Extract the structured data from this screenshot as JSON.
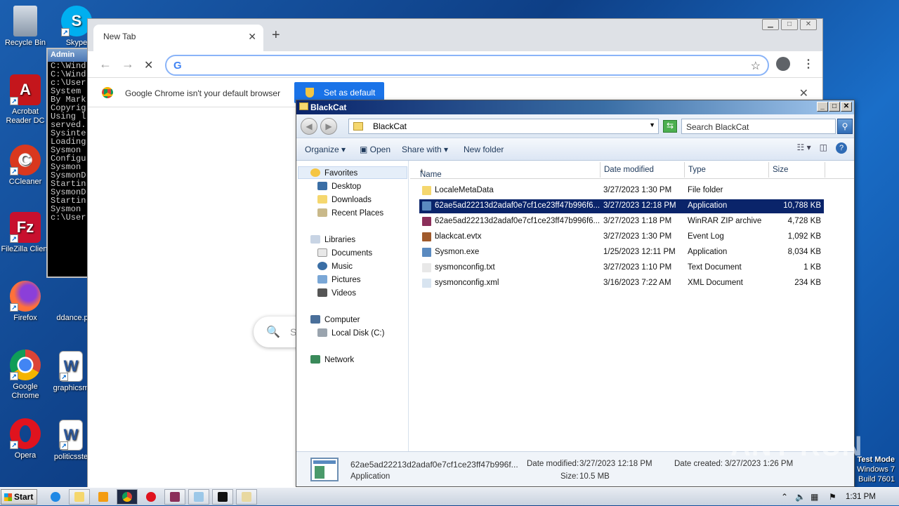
{
  "desktop": {
    "icons": [
      {
        "label": "Recycle Bin",
        "color": "#9aa9b8"
      },
      {
        "label": "Acrobat Reader DC",
        "color": "#c4161c"
      },
      {
        "label": "CCleaner",
        "color": "#d9381e"
      },
      {
        "label": "FileZilla Client",
        "color": "#c8102e"
      },
      {
        "label": "Firefox",
        "color": "#ff7139"
      },
      {
        "label": "Google Chrome",
        "color": "#4285f4"
      },
      {
        "label": "Opera",
        "color": "#e0131e"
      },
      {
        "label": "Skype",
        "color": "#00aff0"
      },
      {
        "label": "ddance.p",
        "color": "#ffffff"
      },
      {
        "label": "graphicsm",
        "color": "#2b579a"
      },
      {
        "label": "politicsste",
        "color": "#2b579a"
      }
    ]
  },
  "cmd": {
    "title": "Admin",
    "lines": [
      "C:\\Wind",
      "",
      "C:\\Wind",
      "",
      "c:\\User",
      "",
      "System",
      "By Mark",
      "Copyrig",
      "Using l",
      "served.",
      "Sysinte",
      "",
      "Loading",
      "Sysmon",
      "Configu",
      "Sysmon",
      "SysmonD",
      "Startin",
      "SysmonD",
      "Startin",
      "Sysmon",
      "",
      "c:\\User"
    ]
  },
  "chrome": {
    "tab_title": "New Tab",
    "tab_close": "✕",
    "new_tab": "+",
    "back": "←",
    "forward": "→",
    "stop": "✕",
    "omnibox_g": "G",
    "star": "☆",
    "menu": "⋮",
    "infobar_message": "Google Chrome isn't your default browser",
    "set_default_label": "Set as default",
    "infobar_close": "✕",
    "search_icon": "🔍",
    "search_partial": "S"
  },
  "explorer": {
    "title": "BlackCat",
    "breadcrumb": "BlackCat",
    "search_placeholder": "Search BlackCat",
    "commands": {
      "organize": "Organize",
      "open": "Open",
      "share_with": "Share with",
      "new_folder": "New folder"
    },
    "nav": {
      "favorites": "Favorites",
      "desktop": "Desktop",
      "downloads": "Downloads",
      "recent_places": "Recent Places",
      "libraries": "Libraries",
      "documents": "Documents",
      "music": "Music",
      "pictures": "Pictures",
      "videos": "Videos",
      "computer": "Computer",
      "local_disk": "Local Disk (C:)",
      "network": "Network"
    },
    "columns": {
      "name": "Name",
      "date_modified": "Date modified",
      "type": "Type",
      "size": "Size"
    },
    "files": [
      {
        "name": "LocaleMetaData",
        "date": "3/27/2023 1:30 PM",
        "type": "File folder",
        "size": "",
        "icon": "#f5d76e"
      },
      {
        "name": "62ae5ad22213d2adaf0e7cf1ce23ff47b996f6...",
        "date": "3/27/2023 12:18 PM",
        "type": "Application",
        "size": "10,788 KB",
        "icon": "#5a8ac0"
      },
      {
        "name": "62ae5ad22213d2adaf0e7cf1ce23ff47b996f6...",
        "date": "3/27/2023 1:18 PM",
        "type": "WinRAR ZIP archive",
        "size": "4,728 KB",
        "icon": "#8b2f5a"
      },
      {
        "name": "blackcat.evtx",
        "date": "3/27/2023 1:30 PM",
        "type": "Event Log",
        "size": "1,092 KB",
        "icon": "#a05a2c"
      },
      {
        "name": "Sysmon.exe",
        "date": "1/25/2023 12:11 PM",
        "type": "Application",
        "size": "8,034 KB",
        "icon": "#5a8ac0"
      },
      {
        "name": "sysmonconfig.txt",
        "date": "3/27/2023 1:10 PM",
        "type": "Text Document",
        "size": "1 KB",
        "icon": "#e8e8e8"
      },
      {
        "name": "sysmonconfig.xml",
        "date": "3/16/2023 7:22 AM",
        "type": "XML Document",
        "size": "234 KB",
        "icon": "#d8e4f0"
      }
    ],
    "details": {
      "name": "62ae5ad22213d2adaf0e7cf1ce23ff47b996f...",
      "type": "Application",
      "date_modified_label": "Date modified:",
      "date_modified": "3/27/2023 12:18 PM",
      "size_label": "Size:",
      "size": "10.5 MB",
      "date_created_label": "Date created:",
      "date_created": "3/27/2023 1:26 PM"
    }
  },
  "watermark": "ANY RUN",
  "test_mode": {
    "line1": "Test Mode",
    "line2": "Windows 7",
    "line3": "Build 7601"
  },
  "taskbar": {
    "start_label": "Start",
    "clock": "1:31 PM"
  }
}
